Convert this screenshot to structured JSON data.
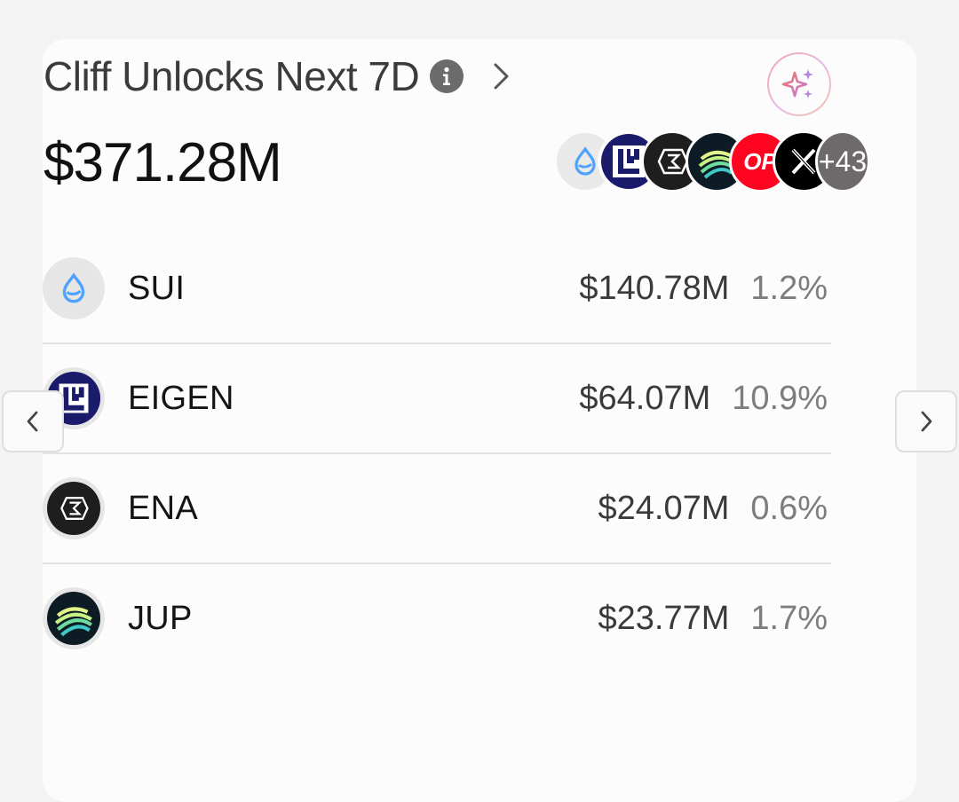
{
  "header": {
    "title": "Cliff Unlocks Next 7D",
    "info_icon": "info-icon",
    "expand_icon": "chevron-right-icon",
    "ai_icon": "sparkles-icon"
  },
  "summary": {
    "total_value": "$371.28M",
    "more_count": "+43",
    "stack_icons": [
      "sui-icon",
      "eigen-icon",
      "ena-icon",
      "jup-icon",
      "op-icon",
      "x-icon"
    ],
    "op_label": "OP"
  },
  "tokens": [
    {
      "symbol": "SUI",
      "value": "$140.78M",
      "pct": "1.2%",
      "icon": "sui-icon"
    },
    {
      "symbol": "EIGEN",
      "value": "$64.07M",
      "pct": "10.9%",
      "icon": "eigen-icon"
    },
    {
      "symbol": "ENA",
      "value": "$24.07M",
      "pct": "0.6%",
      "icon": "ena-icon"
    },
    {
      "symbol": "JUP",
      "value": "$23.77M",
      "pct": "1.7%",
      "icon": "jup-icon"
    }
  ],
  "nav": {
    "prev_icon": "chevron-left-icon",
    "next_icon": "chevron-right-icon"
  },
  "colors": {
    "background": "#f3f3f3",
    "card": "#fcfcfc",
    "sui_blue": "#4da2ff",
    "eigen_navy": "#1a1c6b",
    "op_red": "#ff0420",
    "more_badge": "#6e6a6b"
  }
}
